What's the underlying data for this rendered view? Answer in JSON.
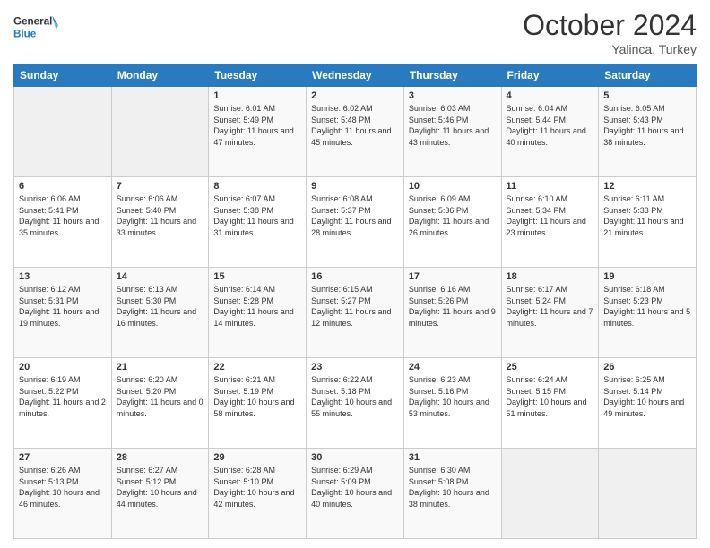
{
  "header": {
    "logo_general": "General",
    "logo_blue": "Blue",
    "month": "October 2024",
    "location": "Yalinca, Turkey"
  },
  "weekdays": [
    "Sunday",
    "Monday",
    "Tuesday",
    "Wednesday",
    "Thursday",
    "Friday",
    "Saturday"
  ],
  "weeks": [
    [
      {
        "day": "",
        "sunrise": "",
        "sunset": "",
        "daylight": ""
      },
      {
        "day": "",
        "sunrise": "",
        "sunset": "",
        "daylight": ""
      },
      {
        "day": "1",
        "sunrise": "Sunrise: 6:01 AM",
        "sunset": "Sunset: 5:49 PM",
        "daylight": "Daylight: 11 hours and 47 minutes."
      },
      {
        "day": "2",
        "sunrise": "Sunrise: 6:02 AM",
        "sunset": "Sunset: 5:48 PM",
        "daylight": "Daylight: 11 hours and 45 minutes."
      },
      {
        "day": "3",
        "sunrise": "Sunrise: 6:03 AM",
        "sunset": "Sunset: 5:46 PM",
        "daylight": "Daylight: 11 hours and 43 minutes."
      },
      {
        "day": "4",
        "sunrise": "Sunrise: 6:04 AM",
        "sunset": "Sunset: 5:44 PM",
        "daylight": "Daylight: 11 hours and 40 minutes."
      },
      {
        "day": "5",
        "sunrise": "Sunrise: 6:05 AM",
        "sunset": "Sunset: 5:43 PM",
        "daylight": "Daylight: 11 hours and 38 minutes."
      }
    ],
    [
      {
        "day": "6",
        "sunrise": "Sunrise: 6:06 AM",
        "sunset": "Sunset: 5:41 PM",
        "daylight": "Daylight: 11 hours and 35 minutes."
      },
      {
        "day": "7",
        "sunrise": "Sunrise: 6:06 AM",
        "sunset": "Sunset: 5:40 PM",
        "daylight": "Daylight: 11 hours and 33 minutes."
      },
      {
        "day": "8",
        "sunrise": "Sunrise: 6:07 AM",
        "sunset": "Sunset: 5:38 PM",
        "daylight": "Daylight: 11 hours and 31 minutes."
      },
      {
        "day": "9",
        "sunrise": "Sunrise: 6:08 AM",
        "sunset": "Sunset: 5:37 PM",
        "daylight": "Daylight: 11 hours and 28 minutes."
      },
      {
        "day": "10",
        "sunrise": "Sunrise: 6:09 AM",
        "sunset": "Sunset: 5:36 PM",
        "daylight": "Daylight: 11 hours and 26 minutes."
      },
      {
        "day": "11",
        "sunrise": "Sunrise: 6:10 AM",
        "sunset": "Sunset: 5:34 PM",
        "daylight": "Daylight: 11 hours and 23 minutes."
      },
      {
        "day": "12",
        "sunrise": "Sunrise: 6:11 AM",
        "sunset": "Sunset: 5:33 PM",
        "daylight": "Daylight: 11 hours and 21 minutes."
      }
    ],
    [
      {
        "day": "13",
        "sunrise": "Sunrise: 6:12 AM",
        "sunset": "Sunset: 5:31 PM",
        "daylight": "Daylight: 11 hours and 19 minutes."
      },
      {
        "day": "14",
        "sunrise": "Sunrise: 6:13 AM",
        "sunset": "Sunset: 5:30 PM",
        "daylight": "Daylight: 11 hours and 16 minutes."
      },
      {
        "day": "15",
        "sunrise": "Sunrise: 6:14 AM",
        "sunset": "Sunset: 5:28 PM",
        "daylight": "Daylight: 11 hours and 14 minutes."
      },
      {
        "day": "16",
        "sunrise": "Sunrise: 6:15 AM",
        "sunset": "Sunset: 5:27 PM",
        "daylight": "Daylight: 11 hours and 12 minutes."
      },
      {
        "day": "17",
        "sunrise": "Sunrise: 6:16 AM",
        "sunset": "Sunset: 5:26 PM",
        "daylight": "Daylight: 11 hours and 9 minutes."
      },
      {
        "day": "18",
        "sunrise": "Sunrise: 6:17 AM",
        "sunset": "Sunset: 5:24 PM",
        "daylight": "Daylight: 11 hours and 7 minutes."
      },
      {
        "day": "19",
        "sunrise": "Sunrise: 6:18 AM",
        "sunset": "Sunset: 5:23 PM",
        "daylight": "Daylight: 11 hours and 5 minutes."
      }
    ],
    [
      {
        "day": "20",
        "sunrise": "Sunrise: 6:19 AM",
        "sunset": "Sunset: 5:22 PM",
        "daylight": "Daylight: 11 hours and 2 minutes."
      },
      {
        "day": "21",
        "sunrise": "Sunrise: 6:20 AM",
        "sunset": "Sunset: 5:20 PM",
        "daylight": "Daylight: 11 hours and 0 minutes."
      },
      {
        "day": "22",
        "sunrise": "Sunrise: 6:21 AM",
        "sunset": "Sunset: 5:19 PM",
        "daylight": "Daylight: 10 hours and 58 minutes."
      },
      {
        "day": "23",
        "sunrise": "Sunrise: 6:22 AM",
        "sunset": "Sunset: 5:18 PM",
        "daylight": "Daylight: 10 hours and 55 minutes."
      },
      {
        "day": "24",
        "sunrise": "Sunrise: 6:23 AM",
        "sunset": "Sunset: 5:16 PM",
        "daylight": "Daylight: 10 hours and 53 minutes."
      },
      {
        "day": "25",
        "sunrise": "Sunrise: 6:24 AM",
        "sunset": "Sunset: 5:15 PM",
        "daylight": "Daylight: 10 hours and 51 minutes."
      },
      {
        "day": "26",
        "sunrise": "Sunrise: 6:25 AM",
        "sunset": "Sunset: 5:14 PM",
        "daylight": "Daylight: 10 hours and 49 minutes."
      }
    ],
    [
      {
        "day": "27",
        "sunrise": "Sunrise: 6:26 AM",
        "sunset": "Sunset: 5:13 PM",
        "daylight": "Daylight: 10 hours and 46 minutes."
      },
      {
        "day": "28",
        "sunrise": "Sunrise: 6:27 AM",
        "sunset": "Sunset: 5:12 PM",
        "daylight": "Daylight: 10 hours and 44 minutes."
      },
      {
        "day": "29",
        "sunrise": "Sunrise: 6:28 AM",
        "sunset": "Sunset: 5:10 PM",
        "daylight": "Daylight: 10 hours and 42 minutes."
      },
      {
        "day": "30",
        "sunrise": "Sunrise: 6:29 AM",
        "sunset": "Sunset: 5:09 PM",
        "daylight": "Daylight: 10 hours and 40 minutes."
      },
      {
        "day": "31",
        "sunrise": "Sunrise: 6:30 AM",
        "sunset": "Sunset: 5:08 PM",
        "daylight": "Daylight: 10 hours and 38 minutes."
      },
      {
        "day": "",
        "sunrise": "",
        "sunset": "",
        "daylight": ""
      },
      {
        "day": "",
        "sunrise": "",
        "sunset": "",
        "daylight": ""
      }
    ]
  ]
}
